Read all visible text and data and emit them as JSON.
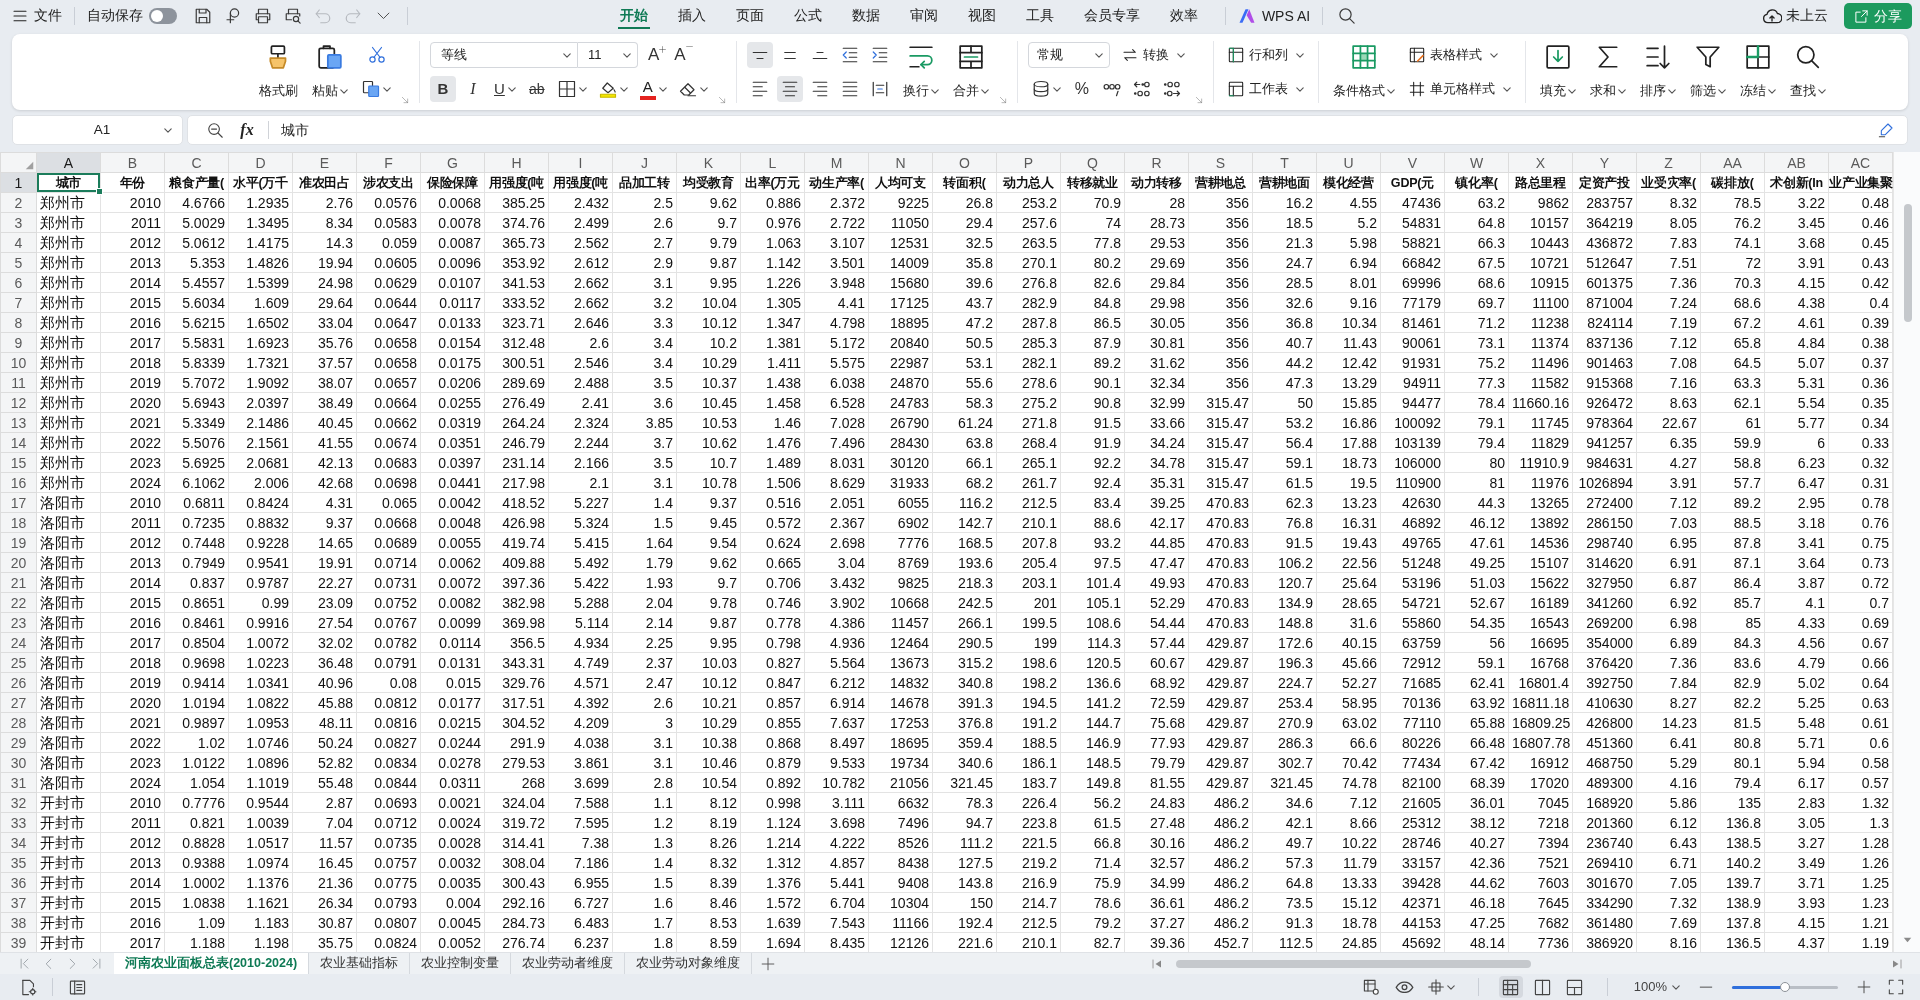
{
  "top_bar": {
    "file_menu": "文件",
    "autosave": {
      "label": "自动保存",
      "on": false
    },
    "quick_tools": [
      {
        "kind": "save",
        "disabled": false
      },
      {
        "kind": "output",
        "disabled": false
      },
      {
        "kind": "print",
        "disabled": false
      },
      {
        "kind": "print_preview",
        "disabled": false
      },
      {
        "kind": "undo",
        "disabled": true
      },
      {
        "kind": "redo",
        "disabled": true
      },
      {
        "kind": "more",
        "disabled": false
      }
    ],
    "tabs": [
      {
        "label": "开始",
        "selected": true
      },
      {
        "label": "插入",
        "selected": false
      },
      {
        "label": "页面",
        "selected": false
      },
      {
        "label": "公式",
        "selected": false
      },
      {
        "label": "数据",
        "selected": false
      },
      {
        "label": "审阅",
        "selected": false
      },
      {
        "label": "视图",
        "selected": false
      },
      {
        "label": "工具",
        "selected": false
      },
      {
        "label": "会员专享",
        "selected": false
      },
      {
        "label": "效率",
        "selected": false
      }
    ],
    "ai": "WPS AI",
    "cloud_status": "未上云",
    "share": "分享"
  },
  "ribbon": {
    "clipboard": {
      "format_painter": "格式刷",
      "paste": "粘贴"
    },
    "font": {
      "family": "等线",
      "size": "11",
      "grow": "A",
      "shrink": "A",
      "styles": [
        {
          "kind": "bold",
          "label": "B",
          "on": true
        },
        {
          "kind": "italic",
          "label": "I",
          "on": false
        },
        {
          "kind": "underline",
          "label": "U",
          "on": false
        },
        {
          "kind": "strike",
          "label": "ab",
          "on": false
        }
      ],
      "color_label": "A"
    },
    "alignment": {
      "vertical": [
        {
          "kind": "top",
          "selected": true
        },
        {
          "kind": "middle",
          "selected": false
        },
        {
          "kind": "bottom",
          "selected": false
        }
      ],
      "horizontal": [
        {
          "kind": "left",
          "selected": false
        },
        {
          "kind": "center",
          "selected": true
        },
        {
          "kind": "right",
          "selected": false
        },
        {
          "kind": "justify",
          "selected": false
        },
        {
          "kind": "distributed",
          "selected": false
        }
      ],
      "wrap": "换行",
      "merge": "合并"
    },
    "number": {
      "format": "常规",
      "convert": "转换",
      "percent": "%"
    },
    "cells": {
      "rows_columns": "行和列",
      "worksheet": "工作表"
    },
    "styles": {
      "conditional": "条件格式",
      "table_style": "表格样式",
      "cell_style": "单元格样式"
    },
    "editing": [
      {
        "kind": "fill",
        "label": "填充"
      },
      {
        "kind": "sum",
        "label": "求和"
      },
      {
        "kind": "sort",
        "label": "排序"
      },
      {
        "kind": "filter",
        "label": "筛选"
      },
      {
        "kind": "freeze",
        "label": "冻结"
      },
      {
        "kind": "find",
        "label": "查找"
      }
    ]
  },
  "formula_bar": {
    "cell_ref": "A1",
    "fx": "fx",
    "formula": "城市"
  },
  "sheet": {
    "columns": [
      {
        "letter": "A",
        "selected": true
      },
      {
        "letter": "B",
        "selected": false
      },
      {
        "letter": "C",
        "selected": false
      },
      {
        "letter": "D",
        "selected": false
      },
      {
        "letter": "E",
        "selected": false
      },
      {
        "letter": "F",
        "selected": false
      },
      {
        "letter": "G",
        "selected": false
      },
      {
        "letter": "H",
        "selected": false
      },
      {
        "letter": "I",
        "selected": false
      },
      {
        "letter": "J",
        "selected": false
      },
      {
        "letter": "K",
        "selected": false
      },
      {
        "letter": "L",
        "selected": false
      },
      {
        "letter": "M",
        "selected": false
      },
      {
        "letter": "N",
        "selected": false
      },
      {
        "letter": "O",
        "selected": false
      },
      {
        "letter": "P",
        "selected": false
      },
      {
        "letter": "Q",
        "selected": false
      },
      {
        "letter": "R",
        "selected": false
      },
      {
        "letter": "S",
        "selected": false
      },
      {
        "letter": "T",
        "selected": false
      },
      {
        "letter": "U",
        "selected": false
      },
      {
        "letter": "V",
        "selected": false
      },
      {
        "letter": "W",
        "selected": false
      },
      {
        "letter": "X",
        "selected": false
      },
      {
        "letter": "Y",
        "selected": false
      },
      {
        "letter": "Z",
        "selected": false
      },
      {
        "letter": "AA",
        "selected": false
      },
      {
        "letter": "AB",
        "selected": false
      },
      {
        "letter": "AC",
        "selected": false
      }
    ],
    "rows": [
      {
        "number": "1",
        "selected": true,
        "kind": "header",
        "cells": [
          "城市",
          "年份",
          "粮食产量(",
          "水平(万千",
          "准农田占",
          "涉农支出",
          "保险保障",
          "用强度(吨",
          "用强度(吨",
          "品加工转",
          "均受教育",
          "出率(万元",
          "动生产率(",
          "人均可支",
          "转面积(",
          "动力总人",
          "转移就业",
          "动力转移",
          "营耕地总",
          "营耕地面",
          "模化经营",
          "GDP(元",
          "镇化率(",
          "路总里程",
          "定资产投",
          "业受灾率(",
          "碳排放(",
          "术创新(In",
          "业产业集聚"
        ]
      },
      {
        "number": "2",
        "selected": false,
        "kind": "data",
        "cells": [
          "郑州市",
          "2010",
          "4.6766",
          "1.2935",
          "2.76",
          "0.0576",
          "0.0068",
          "385.25",
          "2.432",
          "2.5",
          "9.62",
          "0.886",
          "2.372",
          "9225",
          "26.8",
          "253.2",
          "70.9",
          "28",
          "356",
          "16.2",
          "4.55",
          "47436",
          "63.2",
          "9862",
          "283757",
          "8.32",
          "78.5",
          "3.22",
          "0.48"
        ]
      },
      {
        "number": "3",
        "selected": false,
        "kind": "data",
        "cells": [
          "郑州市",
          "2011",
          "5.0029",
          "1.3495",
          "8.34",
          "0.0583",
          "0.0078",
          "374.76",
          "2.499",
          "2.6",
          "9.7",
          "0.976",
          "2.722",
          "11050",
          "29.4",
          "257.6",
          "74",
          "28.73",
          "356",
          "18.5",
          "5.2",
          "54831",
          "64.8",
          "10157",
          "364219",
          "8.05",
          "76.2",
          "3.45",
          "0.46"
        ]
      },
      {
        "number": "4",
        "selected": false,
        "kind": "data",
        "cells": [
          "郑州市",
          "2012",
          "5.0612",
          "1.4175",
          "14.3",
          "0.059",
          "0.0087",
          "365.73",
          "2.562",
          "2.7",
          "9.79",
          "1.063",
          "3.107",
          "12531",
          "32.5",
          "263.5",
          "77.8",
          "29.53",
          "356",
          "21.3",
          "5.98",
          "58821",
          "66.3",
          "10443",
          "436872",
          "7.83",
          "74.1",
          "3.68",
          "0.45"
        ]
      },
      {
        "number": "5",
        "selected": false,
        "kind": "data",
        "cells": [
          "郑州市",
          "2013",
          "5.353",
          "1.4826",
          "19.94",
          "0.0605",
          "0.0096",
          "353.92",
          "2.612",
          "2.9",
          "9.87",
          "1.142",
          "3.501",
          "14009",
          "35.8",
          "270.1",
          "80.2",
          "29.69",
          "356",
          "24.7",
          "6.94",
          "66842",
          "67.5",
          "10721",
          "512647",
          "7.51",
          "72",
          "3.91",
          "0.43"
        ]
      },
      {
        "number": "6",
        "selected": false,
        "kind": "data",
        "cells": [
          "郑州市",
          "2014",
          "5.4557",
          "1.5399",
          "24.98",
          "0.0629",
          "0.0107",
          "341.53",
          "2.662",
          "3.1",
          "9.95",
          "1.226",
          "3.948",
          "15680",
          "39.6",
          "276.8",
          "82.6",
          "29.84",
          "356",
          "28.5",
          "8.01",
          "69996",
          "68.6",
          "10915",
          "601375",
          "7.36",
          "70.3",
          "4.15",
          "0.42"
        ]
      },
      {
        "number": "7",
        "selected": false,
        "kind": "data",
        "cells": [
          "郑州市",
          "2015",
          "5.6034",
          "1.609",
          "29.64",
          "0.0644",
          "0.0117",
          "333.52",
          "2.662",
          "3.2",
          "10.04",
          "1.305",
          "4.41",
          "17125",
          "43.7",
          "282.9",
          "84.8",
          "29.98",
          "356",
          "32.6",
          "9.16",
          "77179",
          "69.7",
          "11100",
          "871004",
          "7.24",
          "68.6",
          "4.38",
          "0.4"
        ]
      },
      {
        "number": "8",
        "selected": false,
        "kind": "data",
        "cells": [
          "郑州市",
          "2016",
          "5.6215",
          "1.6502",
          "33.04",
          "0.0647",
          "0.0133",
          "323.71",
          "2.646",
          "3.3",
          "10.12",
          "1.347",
          "4.798",
          "18895",
          "47.2",
          "287.8",
          "86.5",
          "30.05",
          "356",
          "36.8",
          "10.34",
          "81461",
          "71.2",
          "11238",
          "824114",
          "7.19",
          "67.2",
          "4.61",
          "0.39"
        ]
      },
      {
        "number": "9",
        "selected": false,
        "kind": "data",
        "cells": [
          "郑州市",
          "2017",
          "5.5831",
          "1.6923",
          "35.76",
          "0.0658",
          "0.0154",
          "312.48",
          "2.6",
          "3.4",
          "10.2",
          "1.381",
          "5.172",
          "20840",
          "50.5",
          "285.3",
          "87.9",
          "30.81",
          "356",
          "40.7",
          "11.43",
          "90061",
          "73.1",
          "11374",
          "837136",
          "7.12",
          "65.8",
          "4.84",
          "0.38"
        ]
      },
      {
        "number": "10",
        "selected": false,
        "kind": "data",
        "cells": [
          "郑州市",
          "2018",
          "5.8339",
          "1.7321",
          "37.57",
          "0.0658",
          "0.0175",
          "300.51",
          "2.546",
          "3.4",
          "10.29",
          "1.411",
          "5.575",
          "22987",
          "53.1",
          "282.1",
          "89.2",
          "31.62",
          "356",
          "44.2",
          "12.42",
          "91931",
          "75.2",
          "11496",
          "901463",
          "7.08",
          "64.5",
          "5.07",
          "0.37"
        ]
      },
      {
        "number": "11",
        "selected": false,
        "kind": "data",
        "cells": [
          "郑州市",
          "2019",
          "5.7072",
          "1.9092",
          "38.07",
          "0.0657",
          "0.0206",
          "289.69",
          "2.488",
          "3.5",
          "10.37",
          "1.438",
          "6.038",
          "24870",
          "55.6",
          "278.6",
          "90.1",
          "32.34",
          "356",
          "47.3",
          "13.29",
          "94911",
          "77.3",
          "11582",
          "915368",
          "7.16",
          "63.3",
          "5.31",
          "0.36"
        ]
      },
      {
        "number": "12",
        "selected": false,
        "kind": "data",
        "cells": [
          "郑州市",
          "2020",
          "5.6943",
          "2.0397",
          "38.49",
          "0.0664",
          "0.0255",
          "276.49",
          "2.41",
          "3.6",
          "10.45",
          "1.458",
          "6.528",
          "24783",
          "58.3",
          "275.2",
          "90.8",
          "32.99",
          "315.47",
          "50",
          "15.85",
          "94477",
          "78.4",
          "11660.16",
          "926472",
          "8.63",
          "62.1",
          "5.54",
          "0.35"
        ]
      },
      {
        "number": "13",
        "selected": false,
        "kind": "data",
        "cells": [
          "郑州市",
          "2021",
          "5.3349",
          "2.1486",
          "40.45",
          "0.0662",
          "0.0319",
          "264.24",
          "2.324",
          "3.85",
          "10.53",
          "1.46",
          "7.028",
          "26790",
          "61.24",
          "271.8",
          "91.5",
          "33.66",
          "315.47",
          "53.2",
          "16.86",
          "100092",
          "79.1",
          "11745",
          "978364",
          "22.67",
          "61",
          "5.77",
          "0.34"
        ]
      },
      {
        "number": "14",
        "selected": false,
        "kind": "data",
        "cells": [
          "郑州市",
          "2022",
          "5.5076",
          "2.1561",
          "41.55",
          "0.0674",
          "0.0351",
          "246.79",
          "2.244",
          "3.7",
          "10.62",
          "1.476",
          "7.496",
          "28430",
          "63.8",
          "268.4",
          "91.9",
          "34.24",
          "315.47",
          "56.4",
          "17.88",
          "103139",
          "79.4",
          "11829",
          "941257",
          "6.35",
          "59.9",
          "6",
          "0.33"
        ]
      },
      {
        "number": "15",
        "selected": false,
        "kind": "data",
        "cells": [
          "郑州市",
          "2023",
          "5.6925",
          "2.0681",
          "42.13",
          "0.0683",
          "0.0397",
          "231.14",
          "2.166",
          "3.5",
          "10.7",
          "1.489",
          "8.031",
          "30120",
          "66.1",
          "265.1",
          "92.2",
          "34.78",
          "315.47",
          "59.1",
          "18.73",
          "106000",
          "80",
          "11910.9",
          "984631",
          "4.27",
          "58.8",
          "6.23",
          "0.32"
        ]
      },
      {
        "number": "16",
        "selected": false,
        "kind": "data",
        "cells": [
          "郑州市",
          "2024",
          "6.1062",
          "2.006",
          "42.68",
          "0.0698",
          "0.0441",
          "217.98",
          "2.1",
          "3.1",
          "10.78",
          "1.506",
          "8.629",
          "31933",
          "68.2",
          "261.7",
          "92.4",
          "35.31",
          "315.47",
          "61.5",
          "19.5",
          "110900",
          "81",
          "11976",
          "1026894",
          "3.91",
          "57.7",
          "6.47",
          "0.31"
        ]
      },
      {
        "number": "17",
        "selected": false,
        "kind": "data",
        "cells": [
          "洛阳市",
          "2010",
          "0.6811",
          "0.8424",
          "4.31",
          "0.065",
          "0.0042",
          "418.52",
          "5.227",
          "1.4",
          "9.37",
          "0.516",
          "2.051",
          "6055",
          "116.2",
          "212.5",
          "83.4",
          "39.25",
          "470.83",
          "62.3",
          "13.23",
          "42630",
          "44.3",
          "13265",
          "272400",
          "7.12",
          "89.2",
          "2.95",
          "0.78"
        ]
      },
      {
        "number": "18",
        "selected": false,
        "kind": "data",
        "cells": [
          "洛阳市",
          "2011",
          "0.7235",
          "0.8832",
          "9.37",
          "0.0668",
          "0.0048",
          "426.98",
          "5.324",
          "1.5",
          "9.45",
          "0.572",
          "2.367",
          "6902",
          "142.7",
          "210.1",
          "88.6",
          "42.17",
          "470.83",
          "76.8",
          "16.31",
          "46892",
          "46.12",
          "13892",
          "286150",
          "7.03",
          "88.5",
          "3.18",
          "0.76"
        ]
      },
      {
        "number": "19",
        "selected": false,
        "kind": "data",
        "cells": [
          "洛阳市",
          "2012",
          "0.7448",
          "0.9228",
          "14.65",
          "0.0689",
          "0.0055",
          "419.74",
          "5.415",
          "1.64",
          "9.54",
          "0.624",
          "2.698",
          "7776",
          "168.5",
          "207.8",
          "93.2",
          "44.85",
          "470.83",
          "91.5",
          "19.43",
          "49765",
          "47.61",
          "14536",
          "298740",
          "6.95",
          "87.8",
          "3.41",
          "0.75"
        ]
      },
      {
        "number": "20",
        "selected": false,
        "kind": "data",
        "cells": [
          "洛阳市",
          "2013",
          "0.7949",
          "0.9541",
          "19.91",
          "0.0714",
          "0.0062",
          "409.88",
          "5.492",
          "1.79",
          "9.62",
          "0.665",
          "3.04",
          "8769",
          "193.6",
          "205.4",
          "97.5",
          "47.47",
          "470.83",
          "106.2",
          "22.56",
          "51248",
          "49.25",
          "15107",
          "314620",
          "6.91",
          "87.1",
          "3.64",
          "0.73"
        ]
      },
      {
        "number": "21",
        "selected": false,
        "kind": "data",
        "cells": [
          "洛阳市",
          "2014",
          "0.837",
          "0.9787",
          "22.27",
          "0.0731",
          "0.0072",
          "397.36",
          "5.422",
          "1.93",
          "9.7",
          "0.706",
          "3.432",
          "9825",
          "218.3",
          "203.1",
          "101.4",
          "49.93",
          "470.83",
          "120.7",
          "25.64",
          "53196",
          "51.03",
          "15622",
          "327950",
          "6.87",
          "86.4",
          "3.87",
          "0.72"
        ]
      },
      {
        "number": "22",
        "selected": false,
        "kind": "data",
        "cells": [
          "洛阳市",
          "2015",
          "0.8651",
          "0.99",
          "23.09",
          "0.0752",
          "0.0082",
          "382.98",
          "5.288",
          "2.04",
          "9.78",
          "0.746",
          "3.902",
          "10668",
          "242.5",
          "201",
          "105.1",
          "52.29",
          "470.83",
          "134.9",
          "28.65",
          "54721",
          "52.67",
          "16189",
          "341260",
          "6.92",
          "85.7",
          "4.1",
          "0.7"
        ]
      },
      {
        "number": "23",
        "selected": false,
        "kind": "data",
        "cells": [
          "洛阳市",
          "2016",
          "0.8461",
          "0.9916",
          "27.54",
          "0.0767",
          "0.0099",
          "369.98",
          "5.114",
          "2.14",
          "9.87",
          "0.778",
          "4.386",
          "11457",
          "266.1",
          "199.5",
          "108.6",
          "54.44",
          "470.83",
          "148.8",
          "31.6",
          "55860",
          "54.35",
          "16543",
          "269200",
          "6.98",
          "85",
          "4.33",
          "0.69"
        ]
      },
      {
        "number": "24",
        "selected": false,
        "kind": "data",
        "cells": [
          "洛阳市",
          "2017",
          "0.8504",
          "1.0072",
          "32.02",
          "0.0782",
          "0.0114",
          "356.5",
          "4.934",
          "2.25",
          "9.95",
          "0.798",
          "4.936",
          "12464",
          "290.5",
          "199",
          "114.3",
          "57.44",
          "429.87",
          "172.6",
          "40.15",
          "63759",
          "56",
          "16695",
          "354000",
          "6.89",
          "84.3",
          "4.56",
          "0.67"
        ]
      },
      {
        "number": "25",
        "selected": false,
        "kind": "data",
        "cells": [
          "洛阳市",
          "2018",
          "0.9698",
          "1.0223",
          "36.48",
          "0.0791",
          "0.0131",
          "343.31",
          "4.749",
          "2.37",
          "10.03",
          "0.827",
          "5.564",
          "13673",
          "315.2",
          "198.6",
          "120.5",
          "60.67",
          "429.87",
          "196.3",
          "45.66",
          "72912",
          "59.1",
          "16768",
          "376420",
          "7.36",
          "83.6",
          "4.79",
          "0.66"
        ]
      },
      {
        "number": "26",
        "selected": false,
        "kind": "data",
        "cells": [
          "洛阳市",
          "2019",
          "0.9414",
          "1.0341",
          "40.96",
          "0.08",
          "0.015",
          "329.76",
          "4.571",
          "2.47",
          "10.12",
          "0.847",
          "6.212",
          "14832",
          "340.8",
          "198.2",
          "136.6",
          "68.92",
          "429.87",
          "224.7",
          "52.27",
          "71685",
          "62.41",
          "16801.4",
          "392750",
          "7.84",
          "82.9",
          "5.02",
          "0.64"
        ]
      },
      {
        "number": "27",
        "selected": false,
        "kind": "data",
        "cells": [
          "洛阳市",
          "2020",
          "1.0194",
          "1.0822",
          "45.88",
          "0.0812",
          "0.0177",
          "317.51",
          "4.392",
          "2.6",
          "10.21",
          "0.857",
          "6.914",
          "14678",
          "391.3",
          "194.5",
          "141.2",
          "72.59",
          "429.87",
          "253.4",
          "58.95",
          "70136",
          "63.92",
          "16811.18",
          "410630",
          "8.27",
          "82.2",
          "5.25",
          "0.63"
        ]
      },
      {
        "number": "28",
        "selected": false,
        "kind": "data",
        "cells": [
          "洛阳市",
          "2021",
          "0.9897",
          "1.0953",
          "48.11",
          "0.0816",
          "0.0215",
          "304.52",
          "4.209",
          "3",
          "10.29",
          "0.855",
          "7.637",
          "17253",
          "376.8",
          "191.2",
          "144.7",
          "75.68",
          "429.87",
          "270.9",
          "63.02",
          "77110",
          "65.88",
          "16809.25",
          "426800",
          "14.23",
          "81.5",
          "5.48",
          "0.61"
        ]
      },
      {
        "number": "29",
        "selected": false,
        "kind": "data",
        "cells": [
          "洛阳市",
          "2022",
          "1.02",
          "1.0746",
          "50.24",
          "0.0827",
          "0.0244",
          "291.9",
          "4.038",
          "3.1",
          "10.38",
          "0.868",
          "8.497",
          "18695",
          "359.4",
          "188.5",
          "146.9",
          "77.93",
          "429.87",
          "286.3",
          "66.6",
          "80226",
          "66.48",
          "16807.78",
          "451360",
          "6.41",
          "80.8",
          "5.71",
          "0.6"
        ]
      },
      {
        "number": "30",
        "selected": false,
        "kind": "data",
        "cells": [
          "洛阳市",
          "2023",
          "1.0122",
          "1.0896",
          "52.82",
          "0.0834",
          "0.0278",
          "279.53",
          "3.861",
          "3.1",
          "10.46",
          "0.879",
          "9.533",
          "19734",
          "340.6",
          "186.1",
          "148.5",
          "79.79",
          "429.87",
          "302.7",
          "70.42",
          "77434",
          "67.42",
          "16912",
          "468750",
          "5.29",
          "80.1",
          "5.94",
          "0.58"
        ]
      },
      {
        "number": "31",
        "selected": false,
        "kind": "data",
        "cells": [
          "洛阳市",
          "2024",
          "1.054",
          "1.1019",
          "55.48",
          "0.0844",
          "0.0311",
          "268",
          "3.699",
          "2.8",
          "10.54",
          "0.892",
          "10.782",
          "21056",
          "321.45",
          "183.7",
          "149.8",
          "81.55",
          "429.87",
          "321.45",
          "74.78",
          "82100",
          "68.39",
          "17020",
          "489300",
          "4.16",
          "79.4",
          "6.17",
          "0.57"
        ]
      },
      {
        "number": "32",
        "selected": false,
        "kind": "data",
        "cells": [
          "开封市",
          "2010",
          "0.7776",
          "0.9544",
          "2.87",
          "0.0693",
          "0.0021",
          "324.04",
          "7.588",
          "1.1",
          "8.12",
          "0.998",
          "3.111",
          "6632",
          "78.3",
          "226.4",
          "56.2",
          "24.83",
          "486.2",
          "34.6",
          "7.12",
          "21605",
          "36.01",
          "7045",
          "168920",
          "5.86",
          "135",
          "2.83",
          "1.32"
        ]
      },
      {
        "number": "33",
        "selected": false,
        "kind": "data",
        "cells": [
          "开封市",
          "2011",
          "0.821",
          "1.0039",
          "7.04",
          "0.0712",
          "0.0024",
          "319.72",
          "7.595",
          "1.2",
          "8.19",
          "1.124",
          "3.698",
          "7496",
          "94.7",
          "223.8",
          "61.5",
          "27.48",
          "486.2",
          "42.1",
          "8.66",
          "25312",
          "38.12",
          "7218",
          "201360",
          "6.12",
          "136.8",
          "3.05",
          "1.3"
        ]
      },
      {
        "number": "34",
        "selected": false,
        "kind": "data",
        "cells": [
          "开封市",
          "2012",
          "0.8828",
          "1.0517",
          "11.57",
          "0.0735",
          "0.0028",
          "314.41",
          "7.38",
          "1.3",
          "8.26",
          "1.214",
          "4.222",
          "8526",
          "111.2",
          "221.5",
          "66.8",
          "30.16",
          "486.2",
          "49.7",
          "10.22",
          "28746",
          "40.27",
          "7394",
          "236740",
          "6.43",
          "138.5",
          "3.27",
          "1.28"
        ]
      },
      {
        "number": "35",
        "selected": false,
        "kind": "data",
        "cells": [
          "开封市",
          "2013",
          "0.9388",
          "1.0974",
          "16.45",
          "0.0757",
          "0.0032",
          "308.04",
          "7.186",
          "1.4",
          "8.32",
          "1.312",
          "4.857",
          "8438",
          "127.5",
          "219.2",
          "71.4",
          "32.57",
          "486.2",
          "57.3",
          "11.79",
          "33157",
          "42.36",
          "7521",
          "269410",
          "6.71",
          "140.2",
          "3.49",
          "1.26"
        ]
      },
      {
        "number": "36",
        "selected": false,
        "kind": "data",
        "cells": [
          "开封市",
          "2014",
          "1.0002",
          "1.1376",
          "21.36",
          "0.0775",
          "0.0035",
          "300.43",
          "6.955",
          "1.5",
          "8.39",
          "1.376",
          "5.441",
          "9408",
          "143.8",
          "216.9",
          "75.9",
          "34.99",
          "486.2",
          "64.8",
          "13.33",
          "39428",
          "44.62",
          "7603",
          "301670",
          "7.05",
          "139.7",
          "3.71",
          "1.25"
        ]
      },
      {
        "number": "37",
        "selected": false,
        "kind": "data",
        "cells": [
          "开封市",
          "2015",
          "1.0838",
          "1.1621",
          "26.34",
          "0.0793",
          "0.004",
          "292.16",
          "6.727",
          "1.6",
          "8.46",
          "1.572",
          "6.704",
          "10304",
          "150",
          "214.7",
          "78.6",
          "36.61",
          "486.2",
          "73.5",
          "15.12",
          "42371",
          "46.18",
          "7645",
          "334290",
          "7.32",
          "138.9",
          "3.93",
          "1.23"
        ]
      },
      {
        "number": "38",
        "selected": false,
        "kind": "data",
        "cells": [
          "开封市",
          "2016",
          "1.09",
          "1.183",
          "30.87",
          "0.0807",
          "0.0045",
          "284.73",
          "6.483",
          "1.7",
          "8.53",
          "1.639",
          "7.543",
          "11166",
          "192.4",
          "212.5",
          "79.2",
          "37.27",
          "486.2",
          "91.3",
          "18.78",
          "44153",
          "47.25",
          "7682",
          "361480",
          "7.69",
          "137.8",
          "4.15",
          "1.21"
        ]
      },
      {
        "number": "39",
        "selected": false,
        "kind": "data",
        "cells": [
          "开封市",
          "2017",
          "1.188",
          "1.198",
          "35.75",
          "0.0824",
          "0.0052",
          "276.74",
          "6.237",
          "1.8",
          "8.59",
          "1.694",
          "8.435",
          "12126",
          "221.6",
          "210.1",
          "82.7",
          "39.36",
          "452.7",
          "112.5",
          "24.85",
          "45692",
          "48.14",
          "7736",
          "386920",
          "8.16",
          "136.5",
          "4.37",
          "1.19"
        ]
      }
    ]
  },
  "sheet_tabs": [
    {
      "label": "河南农业面板总表(2010-2024)",
      "selected": true
    },
    {
      "label": "农业基础指标",
      "selected": false
    },
    {
      "label": "农业控制变量",
      "selected": false
    },
    {
      "label": "农业劳动者维度",
      "selected": false
    },
    {
      "label": "农业劳动对象维度",
      "selected": false
    }
  ],
  "status_bar": {
    "views": [
      {
        "kind": "normal",
        "selected": true
      },
      {
        "kind": "page_layout",
        "selected": false
      },
      {
        "kind": "page_break",
        "selected": false
      }
    ],
    "zoom": "100%",
    "zoom_slider": {
      "level": 0.5
    }
  }
}
